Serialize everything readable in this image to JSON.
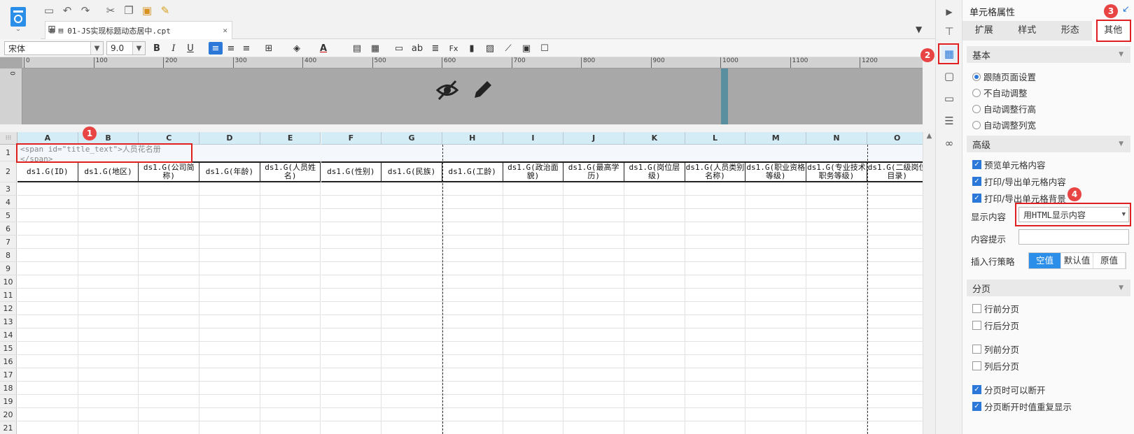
{
  "file_tab": {
    "name": "01-JS实现标题动态居中.cpt",
    "close": "✕"
  },
  "toolbar": {
    "font_name": "宋体",
    "font_size": "9.0"
  },
  "ruler": {
    "ticks": [
      "0",
      "100",
      "200",
      "300",
      "400",
      "500",
      "600",
      "700",
      "800",
      "900",
      "1000",
      "1100",
      "1200"
    ],
    "vertical_label": "0"
  },
  "sheet": {
    "columns": [
      "A",
      "B",
      "C",
      "D",
      "E",
      "F",
      "G",
      "H",
      "I",
      "J",
      "K",
      "L",
      "M",
      "N",
      "O"
    ],
    "rows": [
      "1",
      "2",
      "3",
      "4",
      "5",
      "6",
      "7",
      "8",
      "9",
      "10",
      "11",
      "12",
      "13",
      "14",
      "15",
      "16",
      "17",
      "18",
      "19",
      "20",
      "21"
    ],
    "title_cell": "<span id=\"title_text\">人员花名册</span>",
    "header_cells": [
      "ds1.G(ID)",
      "ds1.G(地区)",
      "ds1.G(公司简称)",
      "ds1.G(年龄)",
      "ds1.G(人员姓名)",
      "ds1.G(性别)",
      "ds1.G(民族)",
      "ds1.G(工龄)",
      "ds1.G(政治面貌)",
      "ds1.G(最高学历)",
      "ds1.G(岗位层级)",
      "ds1.G(人员类别名称)",
      "ds1.G(职业资格等级)",
      "ds1.G(专业技术职务等级)",
      "ds1.G(二级岗位目录)"
    ]
  },
  "panel": {
    "title": "单元格属性",
    "tabs": [
      "扩展",
      "样式",
      "形态",
      "其他"
    ],
    "basic": {
      "title": "基本",
      "options": [
        "跟随页面设置",
        "不自动调整",
        "自动调整行高",
        "自动调整列宽"
      ],
      "selected_index": 0
    },
    "advanced": {
      "title": "高级",
      "checks": [
        "预览单元格内容",
        "打印/导出单元格内容",
        "打印/导出单元格背景"
      ],
      "display_label": "显示内容",
      "display_value": "用HTML显示内容",
      "hint_label": "内容提示",
      "insert_label": "插入行策略",
      "insert_options": [
        "空值",
        "默认值",
        "原值"
      ]
    },
    "paging": {
      "title": "分页",
      "checks": [
        "行前分页",
        "行后分页",
        "列前分页",
        "列后分页",
        "分页时可以断开",
        "分页断开时值重复显示"
      ],
      "checked": [
        false,
        false,
        false,
        false,
        true,
        true
      ]
    }
  },
  "annotations": [
    "1",
    "2",
    "3",
    "4"
  ]
}
